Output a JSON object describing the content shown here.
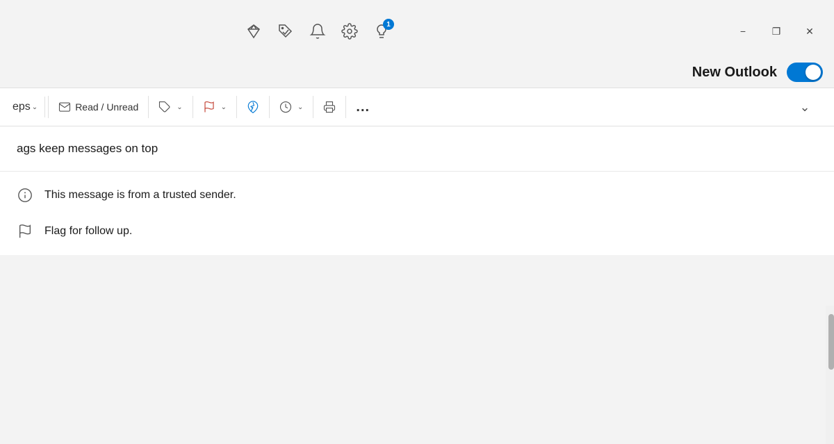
{
  "titlebar": {
    "icons": [
      {
        "name": "diamond-icon",
        "label": "Premium"
      },
      {
        "name": "tag-check-icon",
        "label": "My Day"
      },
      {
        "name": "bell-icon",
        "label": "Notifications"
      },
      {
        "name": "settings-icon",
        "label": "Settings"
      },
      {
        "name": "lightbulb-icon",
        "label": "What's New",
        "badge": "1"
      }
    ],
    "window_controls": {
      "minimize_label": "−",
      "restore_label": "❐",
      "close_label": "✕"
    }
  },
  "new_outlook": {
    "label": "New Outlook",
    "toggle_on": true
  },
  "toolbar": {
    "steps_label": "eps",
    "read_unread_label": "Read / Unread",
    "tag_label": "",
    "flag_label": "",
    "pin_label": "",
    "clock_label": "",
    "print_label": "",
    "more_label": "..."
  },
  "flags_banner": {
    "text": "ags keep messages on top"
  },
  "info_items": [
    {
      "id": "trusted-sender",
      "icon": "info-circle-icon",
      "text": "This message is from a trusted sender."
    },
    {
      "id": "flag-followup",
      "icon": "flag-outline-icon",
      "text": "Flag for follow up."
    }
  ]
}
